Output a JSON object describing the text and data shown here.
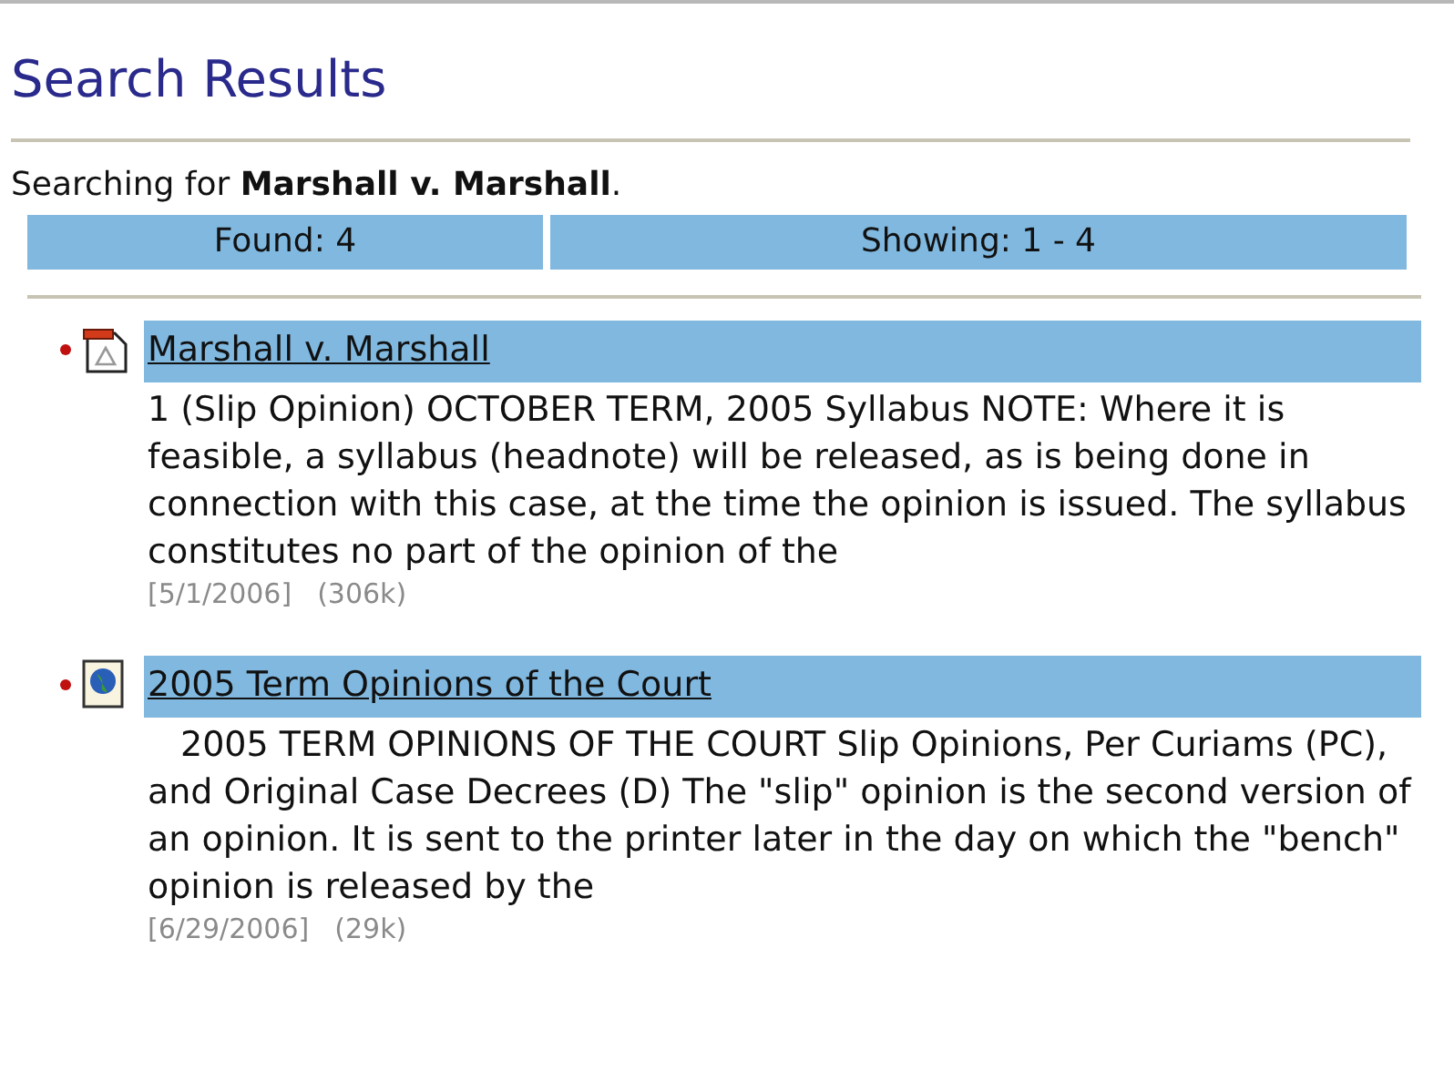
{
  "title": "Search Results",
  "query": "Searching for **Marshall v. Marshall**.",
  "summary": {
    "found": "Found: 4",
    "showing": "Showing: 1 - 4"
  },
  "results": [
    {
      "kind": "pdf",
      "title": "Marshall v. Marshall",
      "snippet": "1 (Slip Opinion) OCTOBER TERM, 2005 Syllabus NOTE: Where it is feasible, a syllabus (headnote) will be released, as is being done in connection with this case, at the time the opinion is issued. The syllabus constitutes no part of the opinion of the",
      "date": "[5/1/2006]",
      "size": "(306k)"
    },
    {
      "kind": "web",
      "title": "2005 Term Opinions of the Court",
      "snippet": "2005 TERM OPINIONS OF THE COURT Slip Opinions, Per Curiams (PC), and Original Case Decrees (D) The \"slip\" opinion is the second version of an opinion. It is sent to the printer later in the day on which the \"bench\" opinion is released by the",
      "date": "[6/29/2006]",
      "size": "(29k)"
    }
  ]
}
